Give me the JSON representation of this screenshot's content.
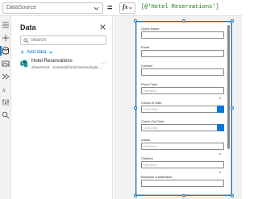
{
  "formula_bar": {
    "property": "DataSource",
    "fx_label": "fx",
    "formula": "[@'Hotel Reservations']"
  },
  "rail": {
    "icons": [
      "tree-view-icon",
      "insert-icon",
      "data-icon",
      "media-icon",
      "power-automate-icon",
      "variables-icon",
      "settings-icon",
      "search-icon"
    ]
  },
  "data_panel": {
    "title": "Data",
    "search_placeholder": "Search",
    "add_data_label": "Add data",
    "data_source": {
      "name": "Hotel Reservations",
      "subtitle": "SharePoint · Sonam@formfortechnologiesl..."
    }
  },
  "form": {
    "fields": [
      {
        "label": "Guest Name",
        "type": "text",
        "placeholder": ""
      },
      {
        "label": "Email",
        "type": "text",
        "placeholder": ""
      },
      {
        "label": "Contact",
        "type": "text",
        "placeholder": ""
      },
      {
        "label": "Room Type",
        "type": "dropdown",
        "placeholder": "Find items"
      },
      {
        "label": "Check-In Date",
        "type": "date",
        "placeholder": "12/31/2001"
      },
      {
        "label": "Check-Out Date",
        "type": "date",
        "placeholder": "12/31/2001"
      },
      {
        "label": "Adults",
        "type": "dropdown",
        "placeholder": "Find items"
      },
      {
        "label": "Children",
        "type": "dropdown",
        "placeholder": "Find items"
      },
      {
        "label": "Business Justification",
        "type": "text",
        "placeholder": ""
      }
    ]
  },
  "colors": {
    "accent": "#0078d4",
    "formula": "#107c10",
    "canvas_bg": "#f3f2f1"
  }
}
